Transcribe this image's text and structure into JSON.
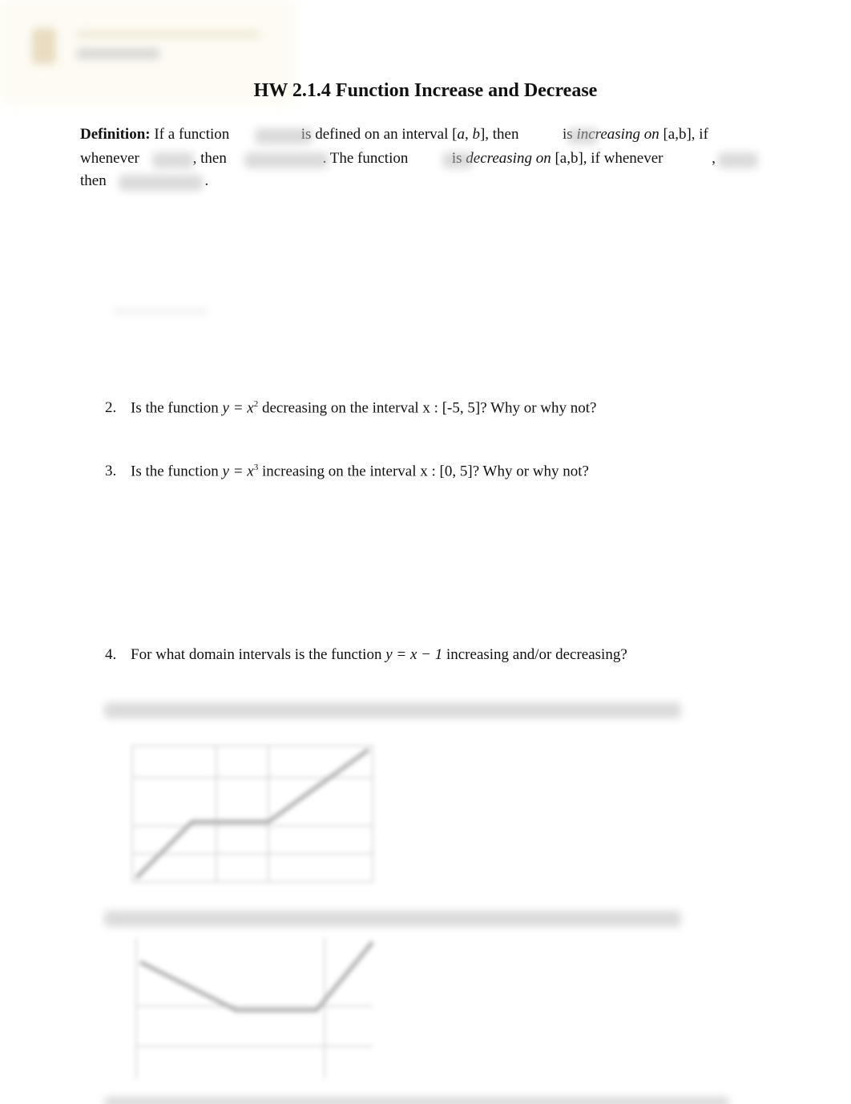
{
  "title": "HW 2.1.4  Function Increase and Decrease",
  "definition": {
    "label": "Definition:",
    "p1": "If a function",
    "p2": "is defined on an interval [",
    "a": "a",
    "comma": ", ",
    "b": "b",
    "p3": "], then",
    "p4": "is ",
    "inc": "increasing on",
    "p5": " [a,b], if",
    "p6": "whenever",
    "p7": ", then",
    "p8": ".  The function",
    "p9": "is ",
    "dec": "decreasing on",
    "p10": " [a,b], if whenever",
    "p11": ",",
    "p12": "then",
    "p13": "."
  },
  "questions": [
    {
      "num": "2.",
      "pre": "Is the function ",
      "fn": "y = x",
      "exp": "2",
      "post": " decreasing on the interval  x : [-5, 5]?  Why or why not?"
    },
    {
      "num": "3.",
      "pre": "Is the function ",
      "fn": "y = x",
      "exp": "3",
      "post": " increasing on the interval  x : [0, 5]?  Why or why not?"
    },
    {
      "num": "4.",
      "pre": "For what domain intervals is the function ",
      "fn": "y =  x − 1",
      "post": "  increasing and/or decreasing?"
    }
  ]
}
